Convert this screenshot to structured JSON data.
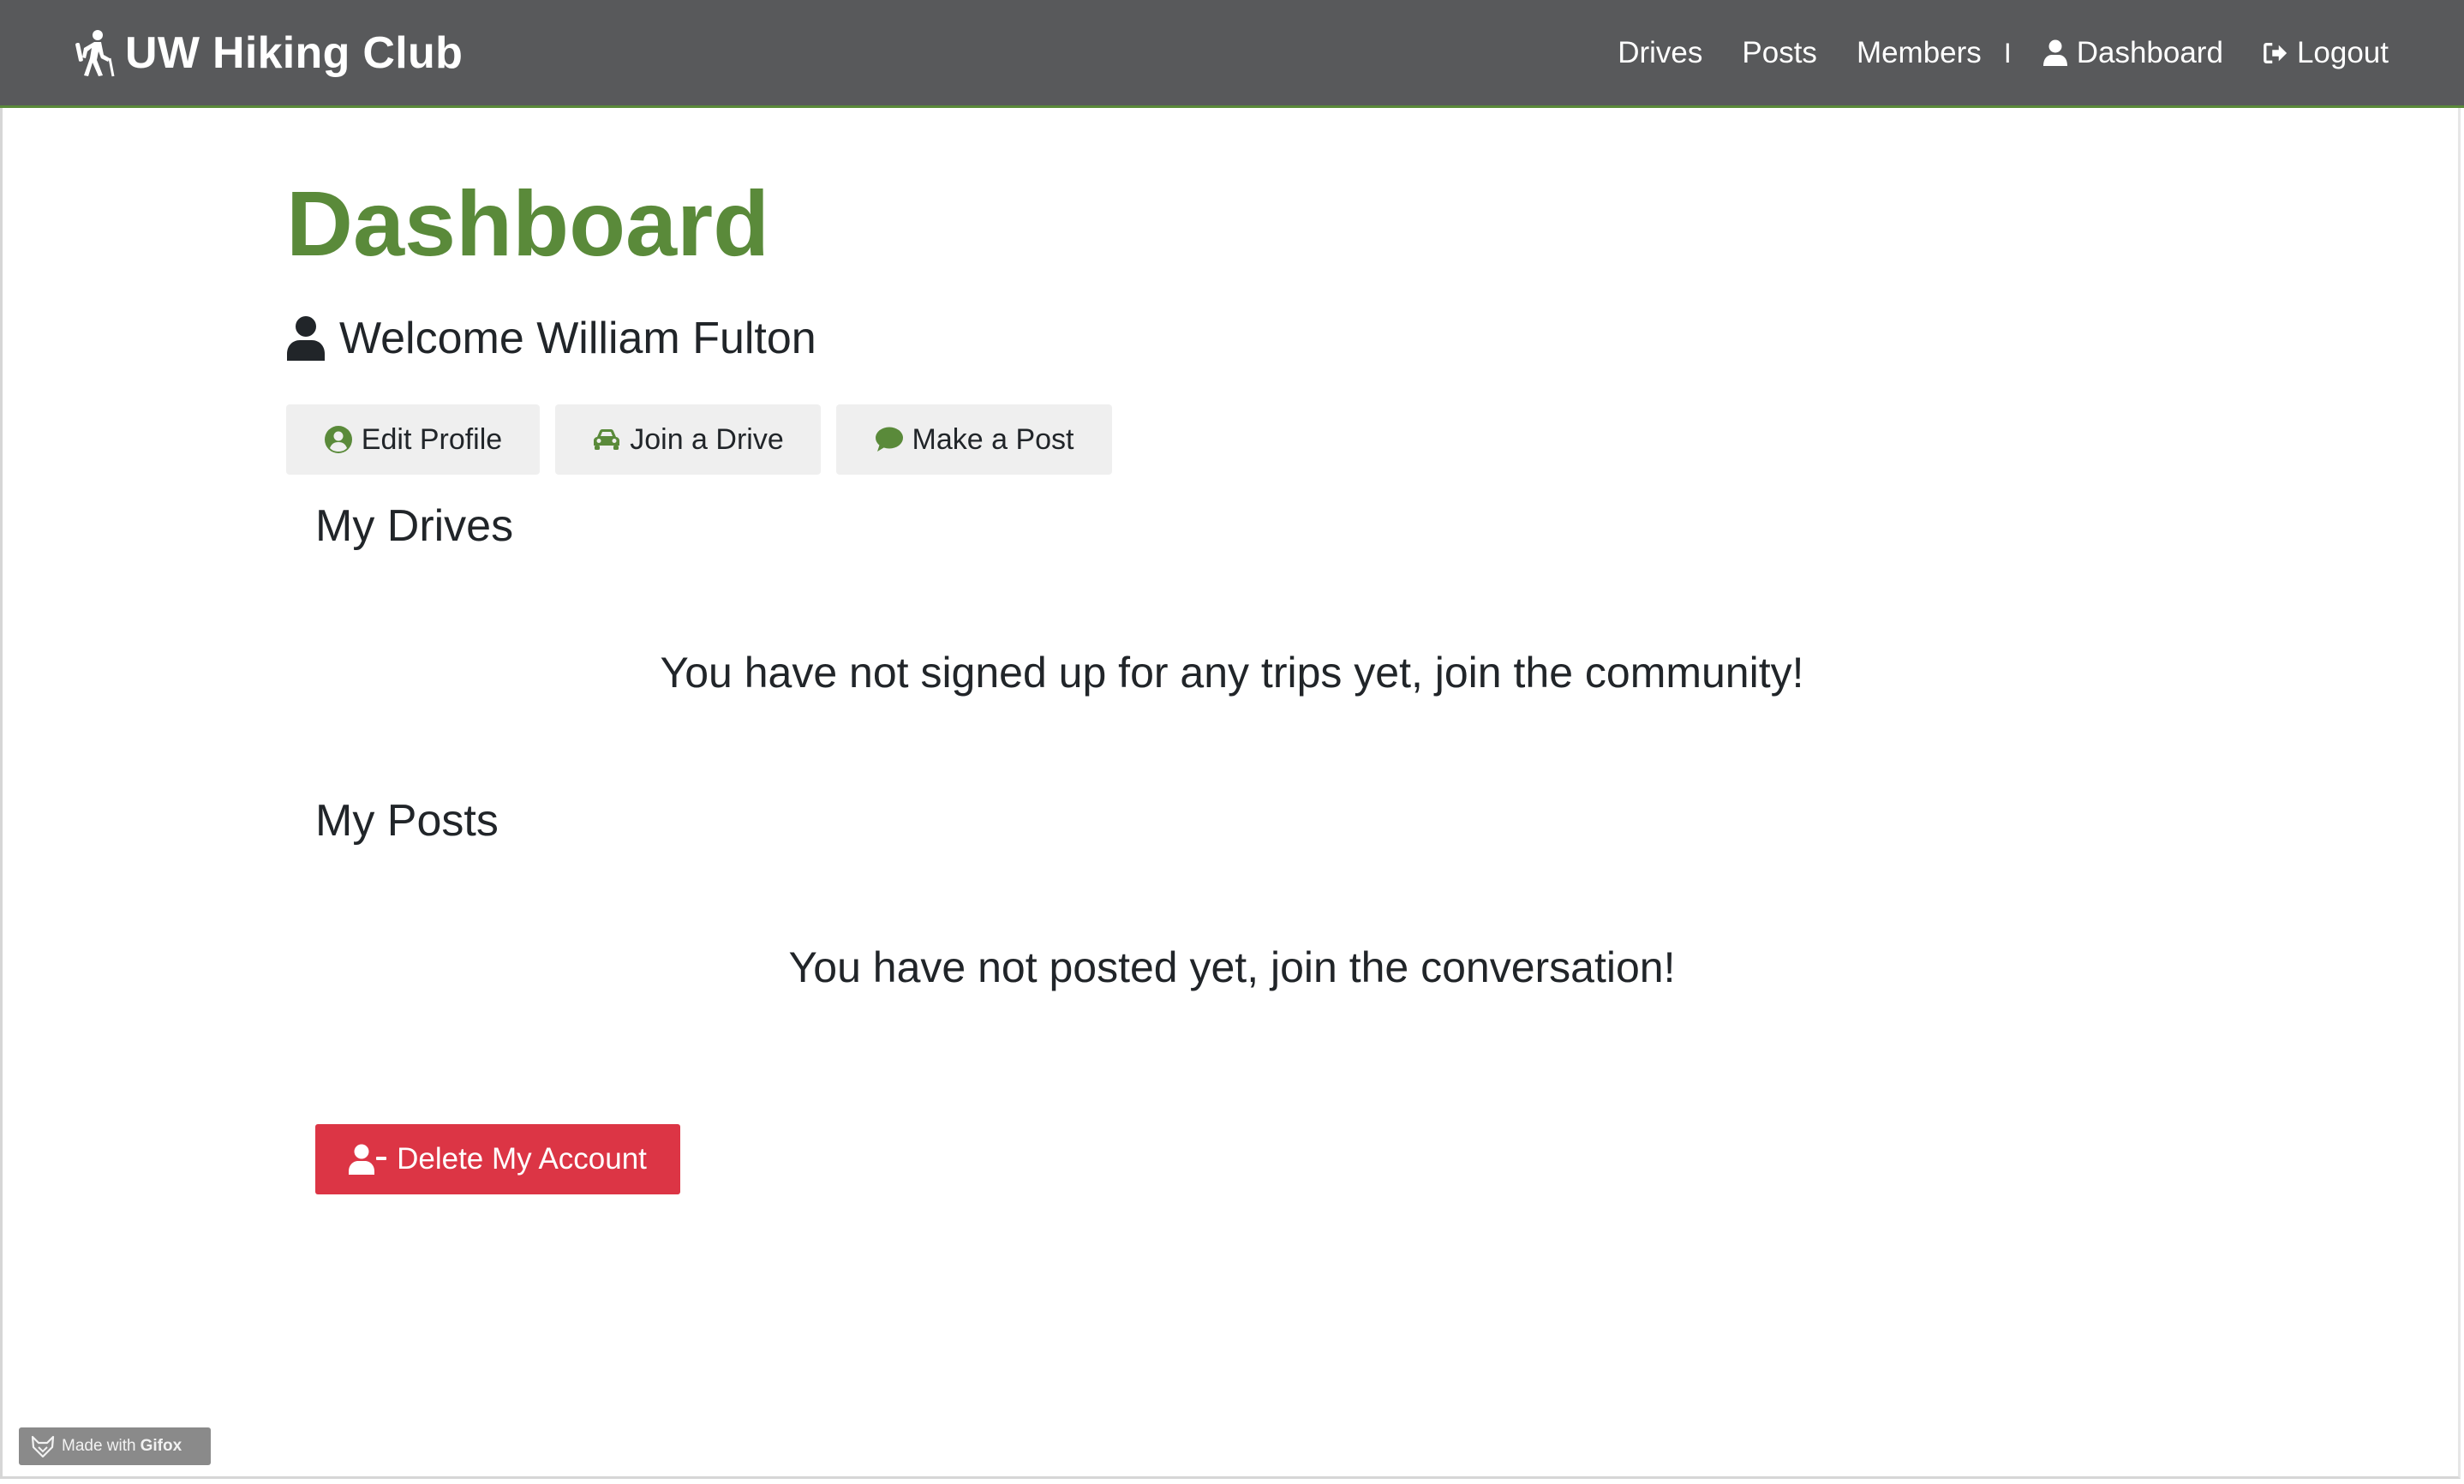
{
  "navbar": {
    "brand": "UW Hiking Club",
    "links": [
      {
        "label": "Drives"
      },
      {
        "label": "Posts"
      },
      {
        "label": "Members"
      },
      {
        "label": "Dashboard"
      },
      {
        "label": "Logout"
      }
    ],
    "separator": "I"
  },
  "main": {
    "title": "Dashboard",
    "welcome": "Welcome William Fulton",
    "actions": {
      "edit_profile": "Edit Profile",
      "join_drive": "Join a Drive",
      "make_post": "Make a Post"
    },
    "drives": {
      "heading": "My Drives",
      "empty_message": "You have not signed up for any trips yet, join the community!"
    },
    "posts": {
      "heading": "My Posts",
      "empty_message": "You have not posted yet, join the conversation!"
    },
    "delete_account": "Delete My Account"
  },
  "watermark": {
    "prefix": "Made with",
    "brand": "Gifox"
  },
  "colors": {
    "navbar_bg": "#58595b",
    "accent_green": "#5a8a3a",
    "danger_red": "#dc3545",
    "button_gray": "#efefef"
  },
  "icons": {
    "brand": "hiking-icon",
    "dashboard": "user-icon",
    "logout": "sign-out-icon",
    "welcome": "user-icon",
    "edit_profile": "user-circle-icon",
    "join_drive": "car-icon",
    "make_post": "comment-icon",
    "delete_account": "user-minus-icon",
    "watermark": "fox-icon"
  }
}
